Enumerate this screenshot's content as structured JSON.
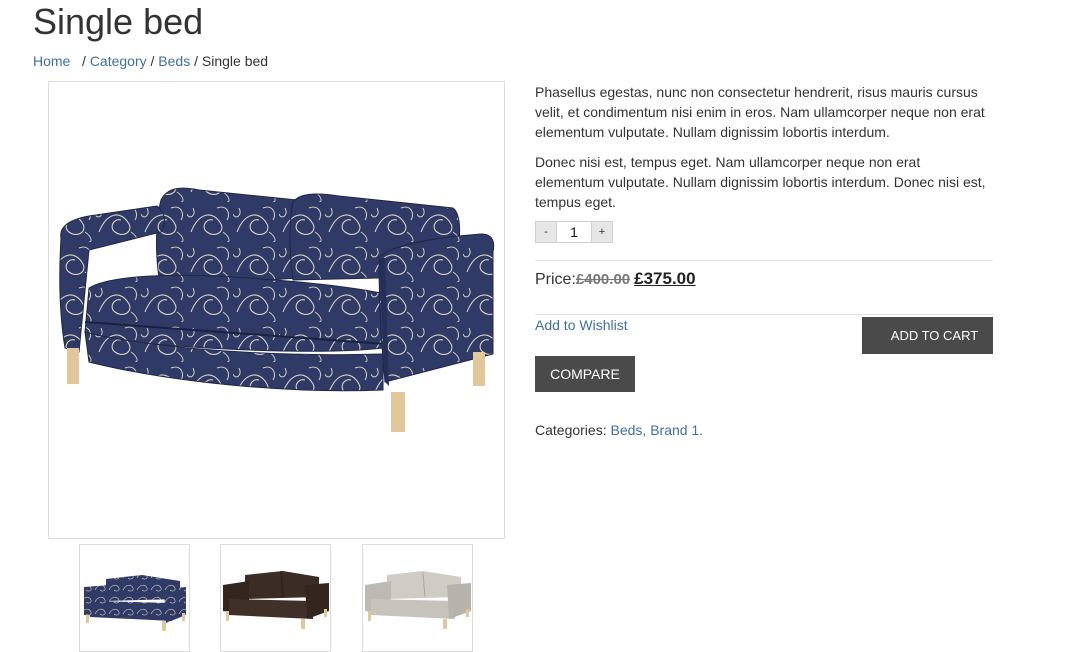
{
  "page": {
    "title": "Single bed"
  },
  "breadcrumb": {
    "items": [
      {
        "label": "Home",
        "link": true
      },
      {
        "label": "Category",
        "link": true
      },
      {
        "label": "Beds",
        "link": true
      },
      {
        "label": "Single bed",
        "link": false
      }
    ],
    "separator": "/"
  },
  "product": {
    "description": [
      "Phasellus egestas, nunc non consectetur hendrerit, risus mauris cursus velit, et condimentum nisi enim in eros. Nam ullamcorper neque non erat elementum vulputate. Nullam dignissim lobortis interdum.",
      "Donec nisi est, tempus eget. Nam ullamcorper neque non erat elementum vulputate. Nullam dignissim lobortis interdum. Donec nisi est, tempus eget."
    ],
    "quantity": {
      "minus_label": "-",
      "value": "1",
      "plus_label": "+"
    },
    "price": {
      "label": "Price:",
      "old": "£400.00",
      "new": "£375.00"
    },
    "wishlist_label": "Add to Wishlist",
    "add_to_cart_label": "Add to cart",
    "compare_label": "COMPARE",
    "categories": {
      "label": "Categories:",
      "items": [
        "Beds",
        "Brand 1"
      ],
      "suffix": "."
    }
  },
  "gallery": {
    "thumbnails": [
      {
        "variant": "blue-floral-sofa"
      },
      {
        "variant": "brown-sofa"
      },
      {
        "variant": "grey-sofa"
      }
    ]
  },
  "colors": {
    "link": "#3f6fa4",
    "button": "#4a4a4a",
    "sofa_blue": "#2f3b66",
    "sofa_brown": "#3b2d25",
    "sofa_grey": "#bdbab3",
    "leg_wood": "#e2c79a"
  }
}
